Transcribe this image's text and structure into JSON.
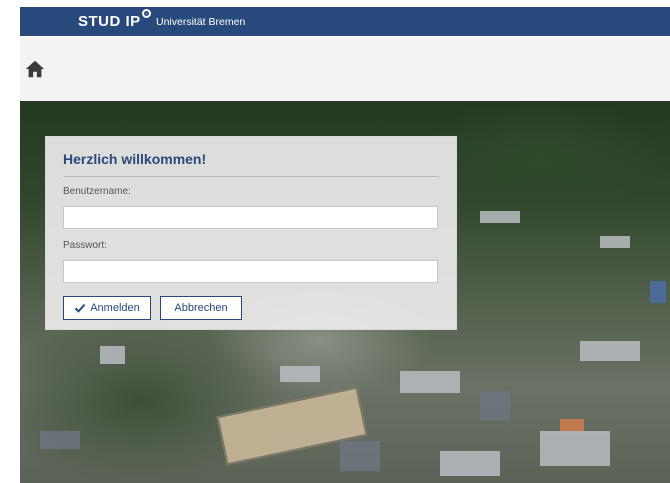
{
  "header": {
    "logo_main": "STUD IP",
    "university": "Universität Bremen"
  },
  "nav": {
    "home_icon": "home-icon"
  },
  "login": {
    "title": "Herzlich willkommen!",
    "username_label": "Benutzername:",
    "username_value": "",
    "password_label": "Passwort:",
    "password_value": "",
    "submit_label": "Anmelden",
    "cancel_label": "Abbrechen"
  },
  "colors": {
    "brand": "#28497c",
    "navbar_bg": "#f3f3f3"
  }
}
